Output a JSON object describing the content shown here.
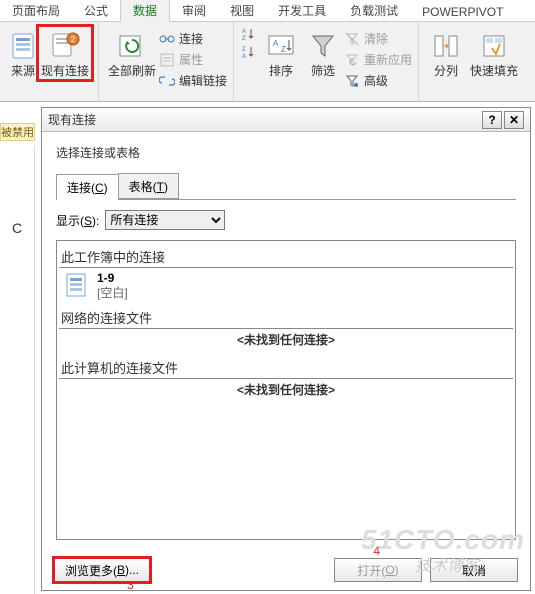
{
  "tabs": {
    "t0": "页面布局",
    "t1": "公式",
    "t2": "数据",
    "t3": "审阅",
    "t4": "视图",
    "t5": "开发工具",
    "t6": "负载测试",
    "t7": "POWERPIVOT"
  },
  "ribbon": {
    "source_label": "来源",
    "existing_conn": "现有连接",
    "refresh_all": "全部刷新",
    "connections": "连接",
    "properties": "属性",
    "edit_links": "编辑链接",
    "sort": "排序",
    "filter": "筛选",
    "clear": "清除",
    "reapply": "重新应用",
    "advanced": "高级",
    "text_to_columns": "分列",
    "flash_fill": "快速填充",
    "sort_az_icon": "A→Z",
    "sort_za_icon": "Z→A"
  },
  "leftstrip": "被禁用",
  "col_header": "C",
  "dialog": {
    "title": "现有连接",
    "help_glyph": "?",
    "close_glyph": "✕",
    "prompt": "选择连接或表格",
    "tab_connections": "连接(",
    "tab_connections_key": "C",
    "tab_connections_close": ")",
    "tab_tables": "表格(",
    "tab_tables_key": "T",
    "tab_tables_close": ")",
    "show_label": "显示(",
    "show_key": "S",
    "show_close": "):",
    "show_value": "所有连接",
    "sect_workbook": "此工作簿中的连接",
    "item1_name": "1-9",
    "item1_desc": "[空白]",
    "sect_network": "网络的连接文件",
    "sect_computer": "此计算机的连接文件",
    "not_found": "<未找到任何连接>",
    "browse_more": "浏览更多(",
    "browse_more_key": "B",
    "browse_more_close": ")...",
    "open": "打开(",
    "open_key": "O",
    "open_close": ")",
    "cancel": "取消"
  },
  "annotations": {
    "n3": "3",
    "n4": "4"
  },
  "watermark": "51CTO.com",
  "watermark2": "技术博客"
}
